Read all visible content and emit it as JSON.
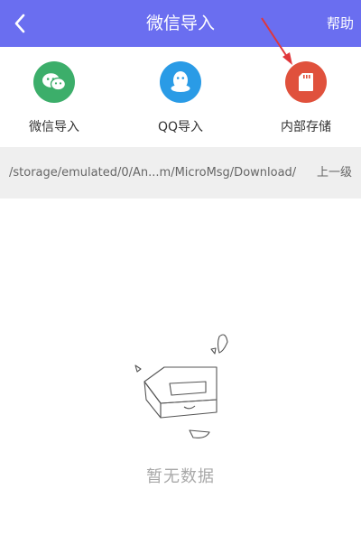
{
  "header": {
    "title": "微信导入",
    "help_label": "帮助"
  },
  "sources": [
    {
      "label": "微信导入",
      "icon": "wechat-icon",
      "color": "#3cae6a"
    },
    {
      "label": "QQ导入",
      "icon": "qq-icon",
      "color": "#2a9be6"
    },
    {
      "label": "内部存储",
      "icon": "sd-card-icon",
      "color": "#e0513c"
    }
  ],
  "pathbar": {
    "path": "/storage/emulated/0/An...m/MicroMsg/Download/",
    "up_label": "上一级"
  },
  "empty_state": {
    "message": "暂无数据"
  },
  "colors": {
    "header_bg": "#6a6ef0",
    "annotation_arrow": "#e0363a"
  }
}
